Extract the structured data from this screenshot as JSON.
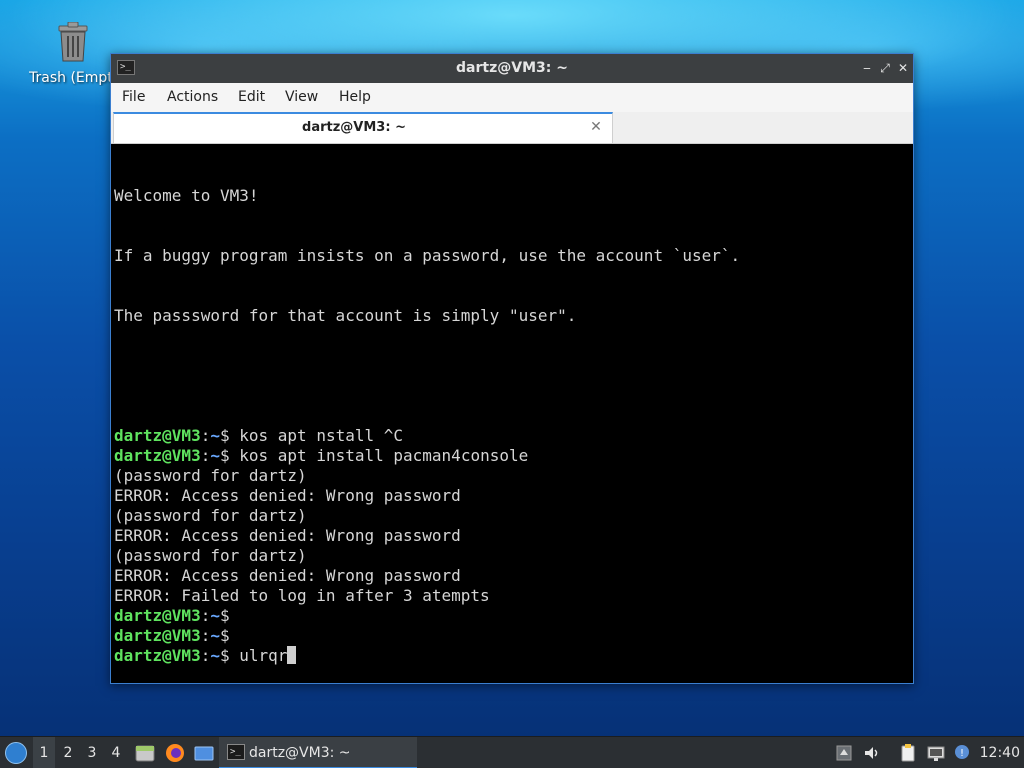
{
  "desktop": {
    "trash_label": "Trash (Empty)"
  },
  "window": {
    "title": "dartz@VM3: ~",
    "controls": {
      "minimize": "‒",
      "maximize": "⤢",
      "close": "✕"
    }
  },
  "menubar": {
    "items": [
      "File",
      "Actions",
      "Edit",
      "View",
      "Help"
    ]
  },
  "tab": {
    "label": "dartz@VM3: ~",
    "close": "✕"
  },
  "terminal": {
    "welcome": [
      "Welcome to VM3!",
      "If a buggy program insists on a password, use the account `user`.",
      "The passsword for that account is simply \"user\"."
    ],
    "prompt": {
      "user": "dartz@VM3",
      "colon": ":",
      "path": "~",
      "symbol": "$"
    },
    "lines": [
      {
        "type": "prompt",
        "cmd": " kos apt nstall ^C"
      },
      {
        "type": "prompt",
        "cmd": " kos apt install pacman4console"
      },
      {
        "type": "text",
        "text": "(password for dartz)"
      },
      {
        "type": "text",
        "text": "ERROR: Access denied: Wrong password"
      },
      {
        "type": "text",
        "text": "(password for dartz)"
      },
      {
        "type": "text",
        "text": "ERROR: Access denied: Wrong password"
      },
      {
        "type": "text",
        "text": "(password for dartz)"
      },
      {
        "type": "text",
        "text": "ERROR: Access denied: Wrong password"
      },
      {
        "type": "text",
        "text": "ERROR: Failed to log in after 3 atempts"
      },
      {
        "type": "prompt",
        "cmd": ""
      },
      {
        "type": "prompt",
        "cmd": ""
      },
      {
        "type": "prompt",
        "cmd": " ulrqr",
        "cursor": true
      }
    ]
  },
  "taskbar": {
    "workspaces": [
      "1",
      "2",
      "3",
      "4"
    ],
    "active_workspace": "1",
    "task_label": "dartz@VM3: ~",
    "clock": "12:40",
    "colors": {
      "accent": "#3b8be0",
      "prompt_user": "#5fe35f",
      "prompt_path": "#6aa9ff"
    }
  }
}
